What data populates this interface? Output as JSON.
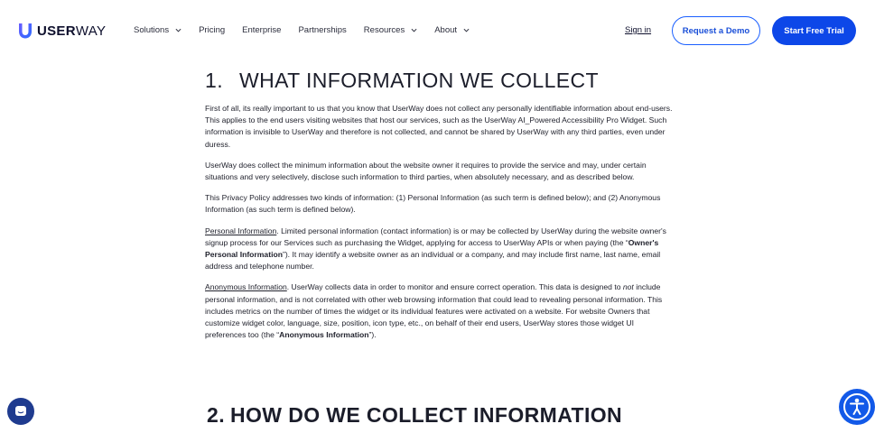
{
  "header": {
    "logo_bold": "USER",
    "logo_thin": "WAY",
    "nav": [
      {
        "label": "Solutions",
        "has_dropdown": true
      },
      {
        "label": "Pricing",
        "has_dropdown": false
      },
      {
        "label": "Enterprise",
        "has_dropdown": false
      },
      {
        "label": "Partnerships",
        "has_dropdown": false
      },
      {
        "label": "Resources",
        "has_dropdown": true
      },
      {
        "label": "About",
        "has_dropdown": true
      }
    ],
    "signin": "Sign in",
    "demo_button": "Request a Demo",
    "trial_button": "Start Free Trial"
  },
  "section1": {
    "number": "1.",
    "title": "WHAT INFORMATION WE COLLECT",
    "p1": "First of all, its really important to us that you know that UserWay does not collect any personally identifiable information about end-users. This applies to the end users visiting websites that host our services, such as the UserWay AI_Powered Accessibility Pro Widget. Such information is invisible to UserWay and therefore is not collected, and cannot be shared by UserWay with any third parties, even under duress.",
    "p2": "UserWay does collect the minimum information about the website owner it requires to provide the service and may, under certain situations and very selectively, disclose such information to third parties, when absolutely necessary, and as described below.",
    "p3": "This Privacy Policy addresses two kinds of information: (1) Personal Information (as such term is defined below); and (2) Anonymous Information (as such term is defined below).",
    "p4_term": "Personal Information",
    "p4_a": ". Limited personal information (contact information) is or may be collected by UserWay during the website owner's signup process for our Services such as purchasing the Widget, applying for access to UserWay APIs or when paying (the “",
    "p4_bold": "Owner's Personal Information",
    "p4_b": "”). It may identify a website owner as an individual or a company, and may include first name, last name, email address and telephone number.",
    "p5_term": "Anonymous Information",
    "p5_a": ". UserWay collects data in order to monitor and ensure correct operation. This data is designed to ",
    "p5_italic": "not",
    "p5_b": " include personal information, and is not correlated with other web browsing information that could lead to revealing personal information. This includes metrics on the number of times the widget or its individual features were activated on a website. For website Owners that customize widget color, language, size, position, icon type, etc., on behalf of their end users, UserWay stores those widget UI preferences too (the “",
    "p5_bold": "Anonymous Information",
    "p5_c": "”)."
  },
  "section2": {
    "number": "2.",
    "title": "HOW DO WE COLLECT INFORMATION"
  },
  "colors": {
    "accent": "#0d47e8",
    "chat": "#1f3b8f",
    "a11y": "#1259e8"
  }
}
